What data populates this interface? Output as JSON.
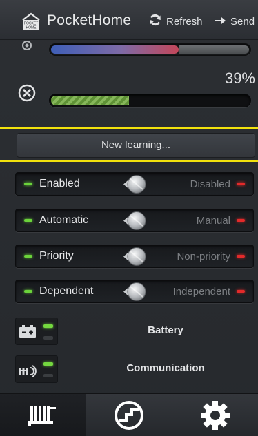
{
  "header": {
    "logo_line1": "POCKET",
    "logo_line2": "HOME",
    "title": "PocketHome",
    "refresh_label": "Refresh",
    "send_label": "Send"
  },
  "status": {
    "temperature_level": 0.64,
    "progress_percent_label": "39%",
    "progress": 0.39
  },
  "learning": {
    "button_label": "New learning..."
  },
  "switches": [
    {
      "left_label": "Enabled",
      "right_label": "Disabled"
    },
    {
      "left_label": "Automatic",
      "right_label": "Manual"
    },
    {
      "left_label": "Priority",
      "right_label": "Non-priority"
    },
    {
      "left_label": "Dependent",
      "right_label": "Independent"
    }
  ],
  "indicators": [
    {
      "icon": "battery-icon",
      "label": "Battery",
      "state": "on"
    },
    {
      "icon": "radiator-signal-icon",
      "label": "Communication",
      "state": "on"
    }
  ],
  "tabs": [
    {
      "icon": "radiator-icon",
      "active": true
    },
    {
      "icon": "gauge-icon",
      "active": false
    },
    {
      "icon": "gear-icon",
      "active": false
    }
  ],
  "colors": {
    "accent_yellow": "#f2e20d",
    "led_green": "#6bd33b",
    "led_red": "#e32a2a",
    "progress_green": "#86b75a"
  }
}
